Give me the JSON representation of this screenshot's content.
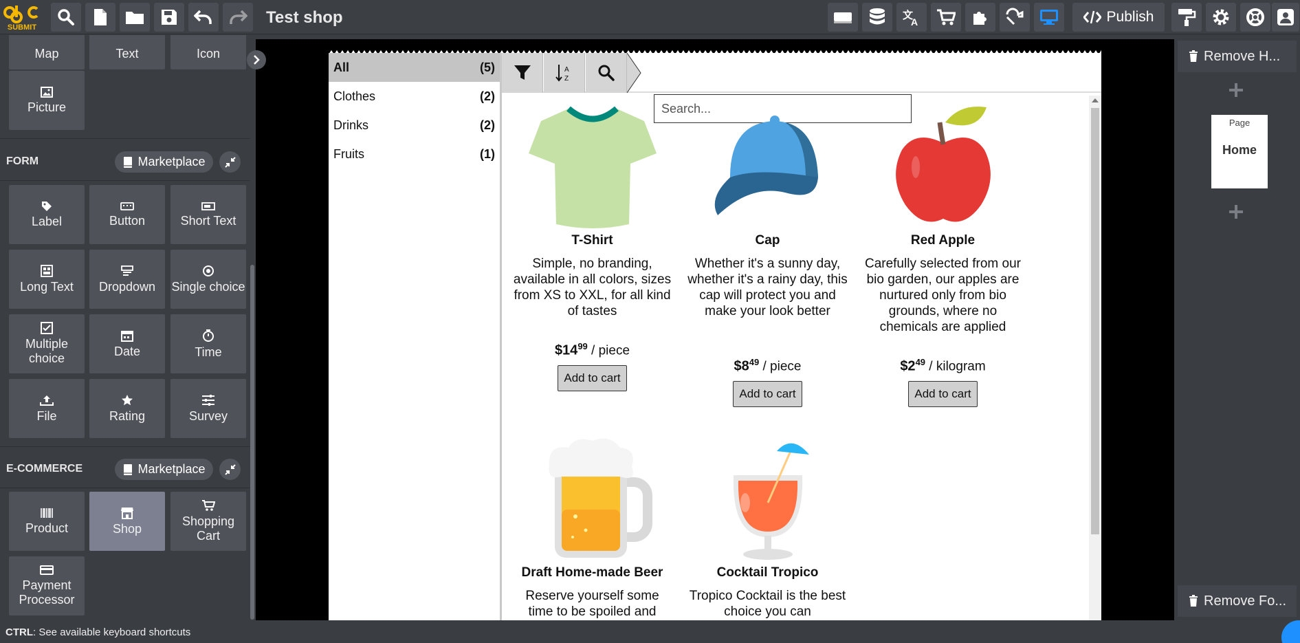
{
  "app": {
    "logo_text": "SUBMIT",
    "title": "Test shop"
  },
  "topbar": {
    "publish_label": "Publish"
  },
  "left_panel": {
    "top_tiles": [
      "Map",
      "Text",
      "Icon"
    ],
    "picture_label": "Picture",
    "form_section": {
      "title": "FORM",
      "marketplace_label": "Marketplace",
      "tiles": [
        "Label",
        "Button",
        "Short Text",
        "Long Text",
        "Dropdown",
        "Single choice",
        "Multiple choice",
        "Date",
        "Time",
        "File",
        "Rating",
        "Survey"
      ]
    },
    "ecommerce_section": {
      "title": "E-COMMERCE",
      "marketplace_label": "Marketplace",
      "tiles": [
        "Product",
        "Shop",
        "Shopping Cart",
        "Payment Processor"
      ],
      "selected": "Shop"
    }
  },
  "status_bar": {
    "key": "CTRL",
    "text": ": See available keyboard shortcuts"
  },
  "shop": {
    "categories": [
      {
        "name": "All",
        "count": "(5)",
        "active": true
      },
      {
        "name": "Clothes",
        "count": "(2)"
      },
      {
        "name": "Drinks",
        "count": "(2)"
      },
      {
        "name": "Fruits",
        "count": "(1)"
      }
    ],
    "search_placeholder": "Search...",
    "add_label": "Add to cart",
    "products": [
      {
        "name": "T-Shirt",
        "desc": "Simple, no branding, available in all colors, sizes from XS to XXL, for all kind of tastes",
        "price_main": "$14",
        "price_cents": "99",
        "unit": " / piece"
      },
      {
        "name": "Cap",
        "desc": "Whether it's a sunny day, whether it's a rainy day, this cap will protect you and make your look better",
        "price_main": "$8",
        "price_cents": "49",
        "unit": " / piece"
      },
      {
        "name": "Red Apple",
        "desc": "Carefully selected from our bio garden, our apples are nurtured only from bio grounds, where no chemicals are applied",
        "price_main": "$2",
        "price_cents": "49",
        "unit": " / kilogram"
      },
      {
        "name": "Draft Home-made Beer",
        "desc": "Reserve yourself some time to be spoiled and"
      },
      {
        "name": "Cocktail Tropico",
        "desc": "Tropico Cocktail is the best choice you can"
      }
    ]
  },
  "right_panel": {
    "remove_header_label": "Remove H...",
    "remove_footer_label": "Remove Fo...",
    "page_card": {
      "label": "Page",
      "name": "Home"
    }
  },
  "colors": {
    "panel_bg": "#3a3d42",
    "tile_bg": "#4f5258",
    "selected_tile": "#7c8090",
    "accent_blue": "#1e90ff"
  }
}
